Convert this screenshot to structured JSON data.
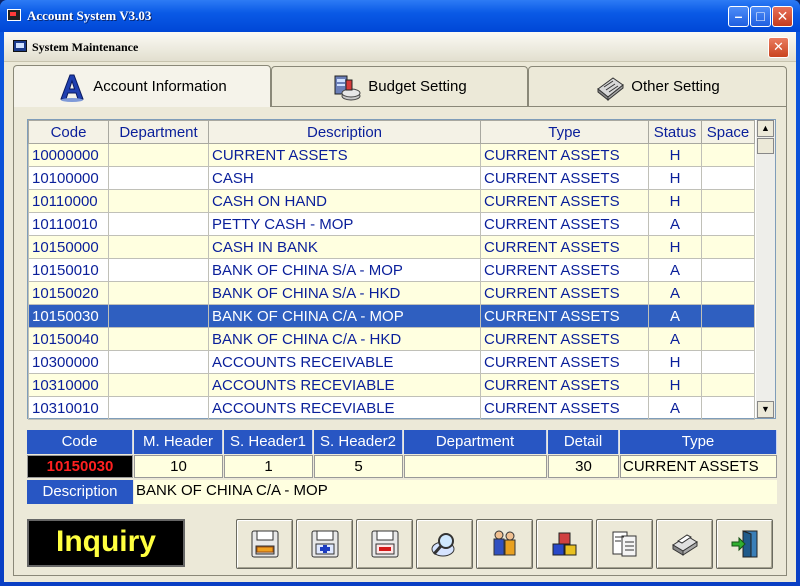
{
  "window": {
    "title": "Account System  V3.03"
  },
  "subwindow": {
    "title": "System Maintenance"
  },
  "tabs": [
    {
      "label": "Account Information",
      "icon": "letter-a-icon"
    },
    {
      "label": "Budget Setting",
      "icon": "budget-icon"
    },
    {
      "label": "Other Setting",
      "icon": "settings-icon"
    }
  ],
  "grid": {
    "columns": [
      "Code",
      "Department",
      "Description",
      "Type",
      "Status",
      "Space"
    ],
    "rows": [
      [
        "10000000",
        "",
        "CURRENT ASSETS",
        "CURRENT  ASSETS",
        "H",
        ""
      ],
      [
        "10100000",
        "",
        "CASH",
        "CURRENT  ASSETS",
        "H",
        ""
      ],
      [
        "10110000",
        "",
        "CASH ON HAND",
        "CURRENT  ASSETS",
        "H",
        ""
      ],
      [
        "10110010",
        "",
        "PETTY CASH - MOP",
        "CURRENT  ASSETS",
        "A",
        ""
      ],
      [
        "10150000",
        "",
        "CASH IN BANK",
        "CURRENT  ASSETS",
        "H",
        ""
      ],
      [
        "10150010",
        "",
        "BANK OF CHINA S/A - MOP",
        "CURRENT  ASSETS",
        "A",
        ""
      ],
      [
        "10150020",
        "",
        "BANK OF CHINA S/A - HKD",
        "CURRENT  ASSETS",
        "A",
        ""
      ],
      [
        "10150030",
        "",
        "BANK OF CHINA C/A - MOP",
        "CURRENT  ASSETS",
        "A",
        ""
      ],
      [
        "10150040",
        "",
        "BANK OF CHINA C/A - HKD",
        "CURRENT  ASSETS",
        "A",
        ""
      ],
      [
        "10300000",
        "",
        "ACCOUNTS RECEIVABLE",
        "CURRENT  ASSETS",
        "H",
        ""
      ],
      [
        "10310000",
        "",
        "ACCOUNTS RECEVIABLE",
        "CURRENT  ASSETS",
        "H",
        ""
      ],
      [
        "10310010",
        "",
        "ACCOUNTS RECEVIABLE",
        "CURRENT  ASSETS",
        "A",
        ""
      ]
    ],
    "selected_row": 7
  },
  "detail": {
    "headers": {
      "code": "Code",
      "m_header": "M. Header",
      "s_header1": "S. Header1",
      "s_header2": "S. Header2",
      "department": "Department",
      "detail": "Detail",
      "type": "Type"
    },
    "values": {
      "code": "10150030",
      "m_header": "10",
      "s_header1": "1",
      "s_header2": "5",
      "department": "",
      "detail": "30",
      "type": "CURRENT  ASSETS"
    },
    "description_label": "Description",
    "description_value": "BANK OF CHINA C/A - MOP"
  },
  "mode": "Inquiry",
  "toolbar": [
    {
      "icon": "save-edit-icon"
    },
    {
      "icon": "save-add-icon"
    },
    {
      "icon": "save-delete-icon"
    },
    {
      "icon": "search-icon"
    },
    {
      "icon": "users-icon"
    },
    {
      "icon": "blocks-icon"
    },
    {
      "icon": "report-icon"
    },
    {
      "icon": "printer-icon"
    },
    {
      "icon": "exit-icon"
    }
  ],
  "colors": {
    "header_blue": "#2856c3",
    "selection": "#2f5fc0",
    "row_alt": "#ffffe0",
    "text_blue": "#0a1f9a",
    "mode_text": "#ffff40",
    "code_red": "#ff2020"
  }
}
